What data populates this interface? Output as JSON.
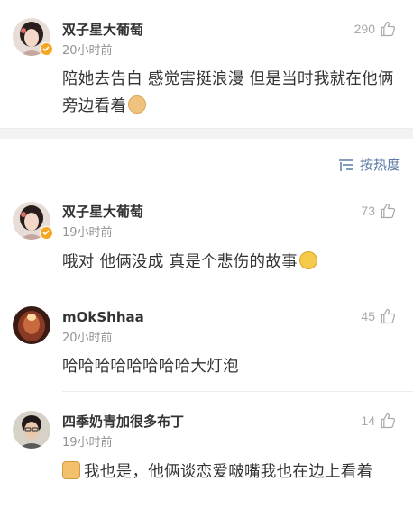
{
  "top_comment": {
    "username": "双子星大葡萄",
    "time": "20小时前",
    "likes": "290",
    "text": "陪她去告白  感觉害挺浪漫  但是当时我就在他俩旁边看着",
    "emoji": "doge-emoji"
  },
  "sort_control": {
    "label": "按热度",
    "icon": "sort-lines-icon",
    "accent_color": "#5b7ba6"
  },
  "replies": [
    {
      "username": "双子星大葡萄",
      "time": "19小时前",
      "likes": "73",
      "text": "哦对  他俩没成 真是个悲伤的故事",
      "emoji": "grin-emoji"
    },
    {
      "username": "mOkShhaa",
      "time": "20小时前",
      "likes": "45",
      "text": "哈哈哈哈哈哈哈哈大灯泡"
    },
    {
      "username": "四季奶青加很多布丁",
      "time": "19小时前",
      "likes": "14",
      "text": "我也是，他俩谈恋爱啵嘴我也在边上看着",
      "emoji": "thumbs-up-emoji"
    }
  ]
}
